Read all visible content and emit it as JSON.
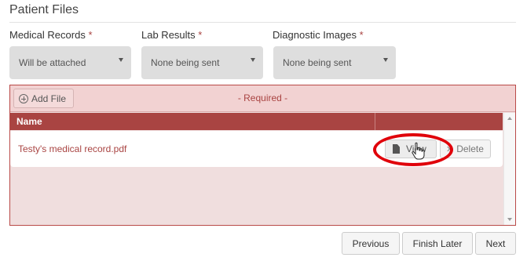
{
  "section": {
    "title": "Patient Files"
  },
  "fields": [
    {
      "label": "Medical Records",
      "required_mark": "*",
      "value": "Will be attached"
    },
    {
      "label": "Lab Results",
      "required_mark": "*",
      "value": "None being sent"
    },
    {
      "label": "Diagnostic Images",
      "required_mark": "*",
      "value": "None being sent"
    }
  ],
  "files_panel": {
    "add_file_label": "Add File",
    "required_text": "- Required -",
    "column_name": "Name",
    "rows": [
      {
        "name": "Testy's medical record.pdf",
        "view_label": "View",
        "delete_label": "Delete"
      }
    ]
  },
  "icons": {
    "add": "plus-circle-icon",
    "view": "file-icon",
    "delete": "x-icon",
    "select": "caret-down-icon",
    "cursor": "hand-pointer-icon"
  },
  "colors": {
    "accent": "#a94442",
    "panel_bg": "#f0dede",
    "highlight": "#e0000a"
  },
  "footer": {
    "previous_label": "Previous",
    "finish_later_label": "Finish Later",
    "next_label": "Next"
  }
}
